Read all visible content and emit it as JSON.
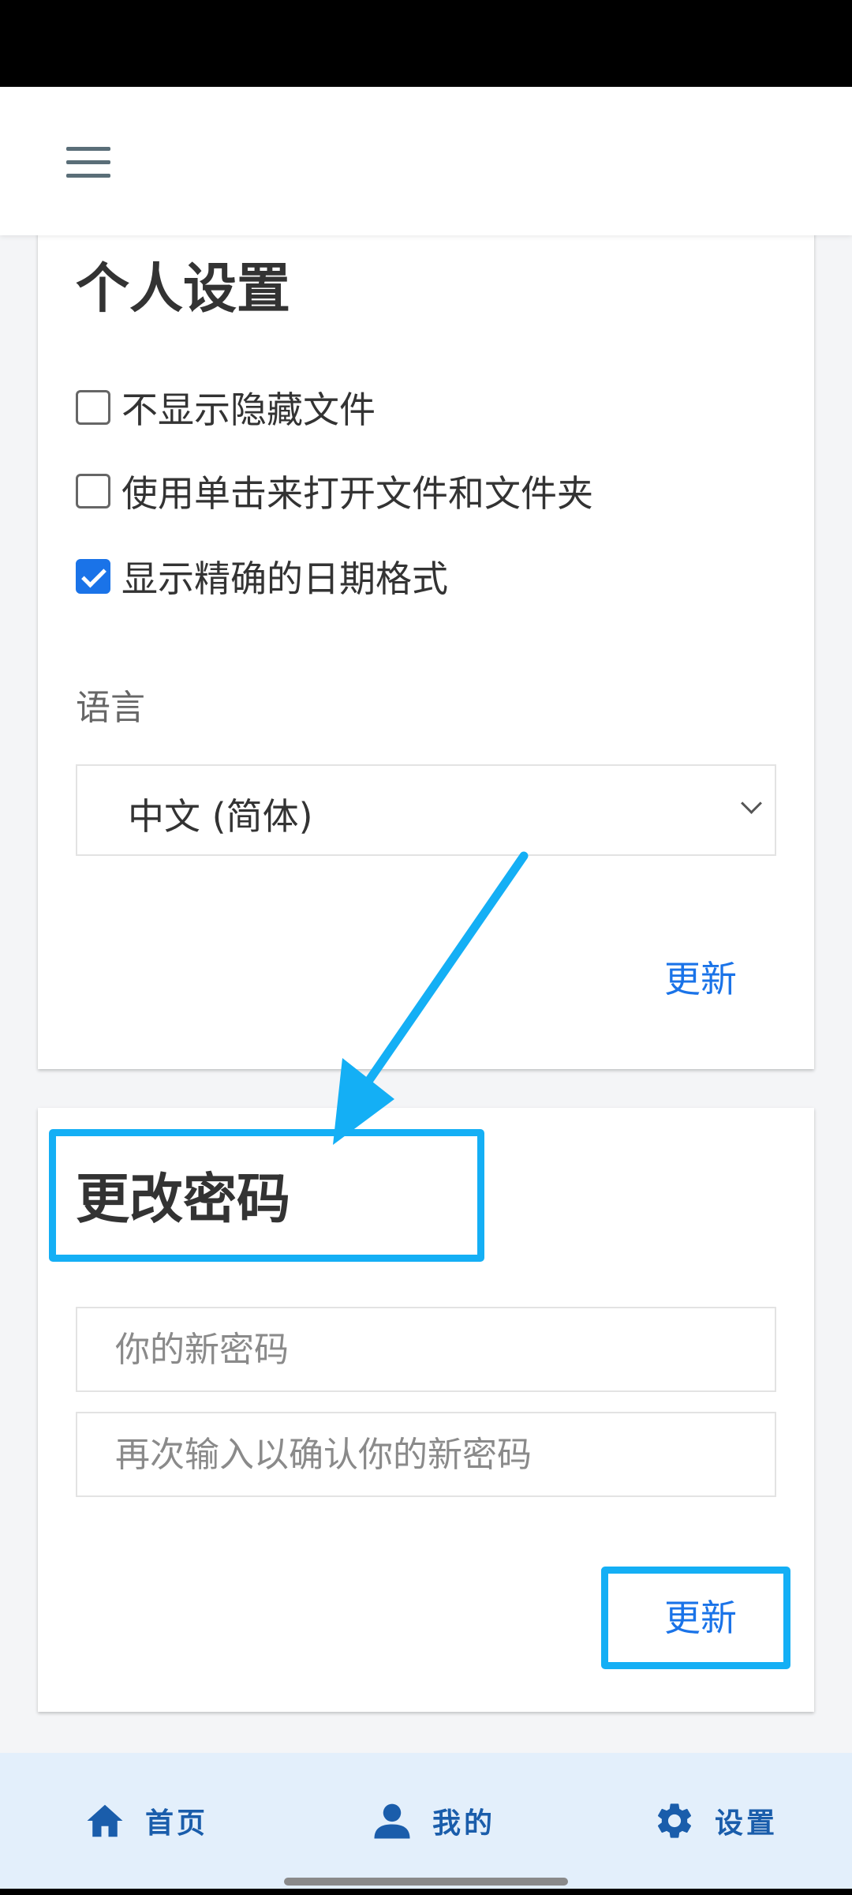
{
  "personal": {
    "title": "个人设置",
    "options": [
      {
        "label": "不显示隐藏文件",
        "checked": false
      },
      {
        "label": "使用单击来打开文件和文件夹",
        "checked": false
      },
      {
        "label": "显示精确的日期格式",
        "checked": true
      }
    ],
    "language_label": "语言",
    "language_value": "中文 (简体)",
    "update_label": "更新"
  },
  "password": {
    "title": "更改密码",
    "new_password_placeholder": "你的新密码",
    "confirm_password_placeholder": "再次输入以确认你的新密码",
    "update_label": "更新"
  },
  "nav": {
    "home": "首页",
    "me": "我的",
    "settings": "设置"
  },
  "colors": {
    "accent": "#1a73e8",
    "highlight": "#14aff5",
    "nav_bg": "#e3effb"
  }
}
